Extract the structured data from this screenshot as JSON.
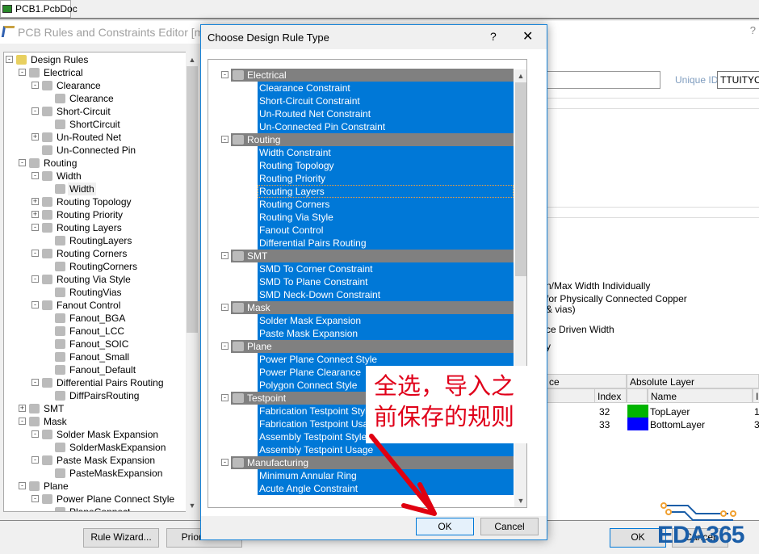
{
  "doc_tab": "PCB1.PcbDoc",
  "editor": {
    "title": "PCB Rules and Constraints Editor [mil]",
    "help": "?"
  },
  "tree": [
    {
      "label": "Design Rules",
      "level": 0,
      "exp": "-"
    },
    {
      "label": "Electrical",
      "level": 1,
      "exp": "-"
    },
    {
      "label": "Clearance",
      "level": 2,
      "exp": "-"
    },
    {
      "label": "Clearance",
      "level": 3
    },
    {
      "label": "Short-Circuit",
      "level": 2,
      "exp": "-"
    },
    {
      "label": "ShortCircuit",
      "level": 3
    },
    {
      "label": "Un-Routed Net",
      "level": 2,
      "exp": "+"
    },
    {
      "label": "Un-Connected Pin",
      "level": 2
    },
    {
      "label": "Routing",
      "level": 1,
      "exp": "-"
    },
    {
      "label": "Width",
      "level": 2,
      "exp": "-"
    },
    {
      "label": "Width",
      "level": 3,
      "selected": true
    },
    {
      "label": "Routing Topology",
      "level": 2,
      "exp": "+"
    },
    {
      "label": "Routing Priority",
      "level": 2,
      "exp": "+"
    },
    {
      "label": "Routing Layers",
      "level": 2,
      "exp": "-"
    },
    {
      "label": "RoutingLayers",
      "level": 3
    },
    {
      "label": "Routing Corners",
      "level": 2,
      "exp": "-"
    },
    {
      "label": "RoutingCorners",
      "level": 3
    },
    {
      "label": "Routing Via Style",
      "level": 2,
      "exp": "-"
    },
    {
      "label": "RoutingVias",
      "level": 3
    },
    {
      "label": "Fanout Control",
      "level": 2,
      "exp": "-"
    },
    {
      "label": "Fanout_BGA",
      "level": 3
    },
    {
      "label": "Fanout_LCC",
      "level": 3
    },
    {
      "label": "Fanout_SOIC",
      "level": 3
    },
    {
      "label": "Fanout_Small",
      "level": 3
    },
    {
      "label": "Fanout_Default",
      "level": 3
    },
    {
      "label": "Differential Pairs Routing",
      "level": 2,
      "exp": "-"
    },
    {
      "label": "DiffPairsRouting",
      "level": 3
    },
    {
      "label": "SMT",
      "level": 1,
      "exp": "+"
    },
    {
      "label": "Mask",
      "level": 1,
      "exp": "-"
    },
    {
      "label": "Solder Mask Expansion",
      "level": 2,
      "exp": "-"
    },
    {
      "label": "SolderMaskExpansion",
      "level": 3
    },
    {
      "label": "Paste Mask Expansion",
      "level": 2,
      "exp": "-"
    },
    {
      "label": "PasteMaskExpansion",
      "level": 3
    },
    {
      "label": "Plane",
      "level": 1,
      "exp": "-"
    },
    {
      "label": "Power Plane Connect Style",
      "level": 2,
      "exp": "-"
    },
    {
      "label": "PlaneConnect",
      "level": 3
    }
  ],
  "right_panel": {
    "unique_id_label": "Unique ID",
    "unique_id": "TTUITYCS",
    "opt1": "n/Max Width Individually",
    "opt2": "for Physically Connected Copper",
    "opt2b": "& vias)",
    "opt3": "ce Driven Width",
    "opt4": "y",
    "grid": {
      "h1": "ce",
      "h2": "Absolute Layer",
      "c_index": "Index",
      "c_name": "Name",
      "c_i": "I",
      "rows": [
        {
          "index": "32",
          "color": "#00b400",
          "name": "TopLayer",
          "i": "1"
        },
        {
          "index": "33",
          "color": "#0000ff",
          "name": "BottomLayer",
          "i": "3"
        }
      ]
    }
  },
  "bottom": {
    "rule_wizard": "Rule Wizard...",
    "priorities": "Priorities...",
    "ok": "OK",
    "cancel": "Cancel"
  },
  "logo": "EDA365",
  "dialog": {
    "title": "Choose Design Rule Type",
    "help": "?",
    "close": "✕",
    "categories": [
      {
        "name": "Electrical",
        "items": [
          "Clearance Constraint",
          "Short-Circuit Constraint",
          "Un-Routed Net Constraint",
          "Un-Connected Pin Constraint"
        ]
      },
      {
        "name": "Routing",
        "items": [
          "Width Constraint",
          "Routing Topology",
          "Routing Priority",
          "Routing Layers",
          "Routing Corners",
          "Routing Via Style",
          "Fanout Control",
          "Differential Pairs Routing"
        ]
      },
      {
        "name": "SMT",
        "items": [
          "SMD To Corner Constraint",
          "SMD To Plane Constraint",
          "SMD Neck-Down Constraint"
        ]
      },
      {
        "name": "Mask",
        "items": [
          "Solder Mask Expansion",
          "Paste Mask Expansion"
        ]
      },
      {
        "name": "Plane",
        "items": [
          "Power Plane Connect Style",
          "Power Plane Clearance",
          "Polygon Connect Style"
        ]
      },
      {
        "name": "Testpoint",
        "items": [
          "Fabrication Testpoint Style",
          "Fabrication Testpoint Usage",
          "Assembly Testpoint Style",
          "Assembly Testpoint Usage"
        ]
      },
      {
        "name": "Manufacturing",
        "items": [
          "Minimum Annular Ring",
          "Acute Angle Constraint"
        ]
      }
    ],
    "focused_item": "Routing Layers",
    "ok": "OK",
    "cancel": "Cancel"
  },
  "annotation": {
    "line1": "全选，导入之",
    "line2": "前保存的规则",
    "color": "#e0001a"
  }
}
